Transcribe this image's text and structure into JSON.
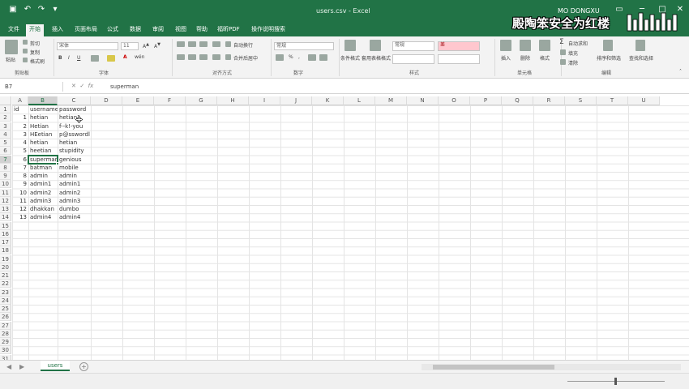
{
  "window": {
    "title": "users.csv - Excel",
    "user": "MO DONGXU",
    "watermark": "殿陶笨安全为红楼",
    "accent_color": "#217346"
  },
  "tabs": [
    {
      "label": "文件",
      "active": false
    },
    {
      "label": "开始",
      "active": true
    },
    {
      "label": "插入",
      "active": false
    },
    {
      "label": "页面布局",
      "active": false
    },
    {
      "label": "公式",
      "active": false
    },
    {
      "label": "数据",
      "active": false
    },
    {
      "label": "审阅",
      "active": false
    },
    {
      "label": "视图",
      "active": false
    },
    {
      "label": "帮助",
      "active": false
    },
    {
      "label": "福昕PDF",
      "active": false
    },
    {
      "label": "操作说明搜索",
      "active": false
    }
  ],
  "ribbon": {
    "clipboard": {
      "paste": "粘贴",
      "cut": "剪切",
      "copy": "复制",
      "format_painter": "格式刷",
      "group": "剪贴板"
    },
    "font": {
      "name": "宋体",
      "size": "11",
      "group": "字体"
    },
    "alignment": {
      "wrap": "自动换行",
      "merge": "合并后居中",
      "group": "对齐方式"
    },
    "number": {
      "format": "常规",
      "group": "数字"
    },
    "styles": {
      "conditional": "条件格式",
      "table": "套用表格格式",
      "normal": "常规",
      "bad": "差",
      "group": "样式"
    },
    "cells": {
      "insert": "插入",
      "delete": "删除",
      "format": "格式",
      "group": "单元格"
    },
    "editing": {
      "autosum": "自动求和",
      "fill": "填充",
      "clear": "清除",
      "sort": "排序和筛选",
      "find": "查找和选择",
      "group": "编辑"
    }
  },
  "formula_bar": {
    "name_box": "B7",
    "formula": "superman"
  },
  "grid": {
    "selected_cell": "B7",
    "columns": [
      "A",
      "B",
      "C",
      "D",
      "E",
      "F",
      "G",
      "H",
      "I",
      "J",
      "K",
      "L",
      "M",
      "N",
      "O",
      "P",
      "Q",
      "R",
      "S",
      "T",
      "U"
    ],
    "row_count": 31,
    "rows": [
      {
        "id": "id",
        "username": "username",
        "password": "password"
      },
      {
        "id": "1",
        "username": "hetian",
        "password": "hetian1"
      },
      {
        "id": "2",
        "username": "Hetian",
        "password": "f--k!-you"
      },
      {
        "id": "3",
        "username": "HEetian",
        "password": "p@sswordl"
      },
      {
        "id": "4",
        "username": "hetian",
        "password": "hetian"
      },
      {
        "id": "5",
        "username": "heetian",
        "password": "stupidity"
      },
      {
        "id": "6",
        "username": "superman",
        "password": "genious"
      },
      {
        "id": "7",
        "username": "batman",
        "password": "mobile"
      },
      {
        "id": "8",
        "username": "admin",
        "password": "admin"
      },
      {
        "id": "9",
        "username": "admin1",
        "password": "admin1"
      },
      {
        "id": "10",
        "username": "admin2",
        "password": "admin2"
      },
      {
        "id": "11",
        "username": "admin3",
        "password": "admin3"
      },
      {
        "id": "12",
        "username": "dhakkan",
        "password": "dumbo"
      },
      {
        "id": "13",
        "username": "admin4",
        "password": "admin4"
      }
    ]
  },
  "sheet_tabs": [
    {
      "label": "users",
      "active": true
    }
  ],
  "status": {
    "zoom": "100%"
  }
}
